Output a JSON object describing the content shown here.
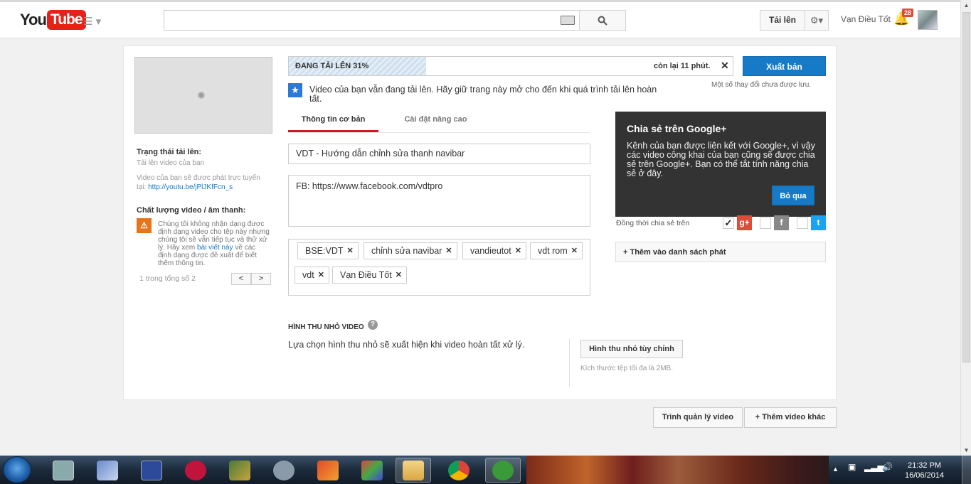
{
  "header": {
    "logo_you": "You",
    "logo_tube": "Tube",
    "search_placeholder": "",
    "upload_label": "Tải lên",
    "username": "Vạn Điều Tốt",
    "notification_count": "28"
  },
  "upload": {
    "progress_label": "ĐANG TẢI LÊN 31%",
    "progress_fraction": 0.31,
    "remaining": "còn lại 11 phút.",
    "publish_label": "Xuất bản",
    "unsaved_note": "Một số thay đổi chưa được lưu.",
    "info_message": "Video của bạn vẫn đang tải lên. Hãy giữ trang này mở cho đến khi quá trình tải lên hoàn tất."
  },
  "sidebar": {
    "status_heading": "Trạng thái tải lên:",
    "status_text": "Tải lên video của bạn",
    "live_text": "Video của bạn sẽ được phát trực tuyến tại:",
    "live_link": "http://youtu.be/jPlJKfFcn_s",
    "quality_heading": "Chất lượng video / âm thanh:",
    "quality_warning_pre": "Chúng tôi không nhận dạng được định dạng video cho tệp này nhưng chúng tôi sẽ vẫn tiếp tục và thử xử lý. Hãy xem ",
    "quality_warning_link": "bài viết này",
    "quality_warning_post": " về các định dạng được đề xuất để biết thêm thông tin.",
    "page_info": "1 trong tổng số 2",
    "prev": "<",
    "next": ">"
  },
  "tabs": [
    {
      "label": "Thông tin cơ bản",
      "active": true
    },
    {
      "label": "Cài đặt nâng cao",
      "active": false
    }
  ],
  "form": {
    "title_value": "VDT - Hướng dẫn chỉnh sửa thanh navibar",
    "description_value": "FB: https://www.facebook.com/vdtpro",
    "tags": [
      "BSE:VDT",
      "chỉnh sửa navibar",
      "vandieutot",
      "vdt rom",
      "vdt",
      "Vạn Điều Tốt"
    ]
  },
  "thumbnail": {
    "heading": "HÌNH THU NHỎ VIDEO",
    "help": "?",
    "description": "Lựa chọn hình thu nhỏ sẽ xuất hiện khi video hoàn tất xử lý.",
    "custom_button": "Hình thu nhỏ tùy chỉnh",
    "max_size": "Kích thước tệp tối đa là 2MB."
  },
  "gplus_popup": {
    "title": "Chia sẻ trên Google+",
    "body": "Kênh của bạn được liên kết với Google+, vì vậy các video công khai của bạn cũng sẽ được chia sẻ trên Google+. Bạn có thể tắt tính năng chia sẻ ở đây.",
    "skip_label": "Bỏ qua"
  },
  "share": {
    "label": "Đồng thời chia sẻ trên",
    "gplus_checked": true,
    "facebook_checked": false,
    "twitter_checked": false
  },
  "playlist_label": "+ Thêm vào danh sách phát",
  "bottom": {
    "video_manager": "Trình quản lý video",
    "add_more": "Thêm video khác"
  },
  "taskbar": {
    "time": "21:32 PM",
    "date": "16/06/2014"
  },
  "colors": {
    "brand_red": "#e62117",
    "primary_blue": "#167ac6",
    "tab_underline": "#cc181e",
    "popup_bg": "#333333"
  }
}
